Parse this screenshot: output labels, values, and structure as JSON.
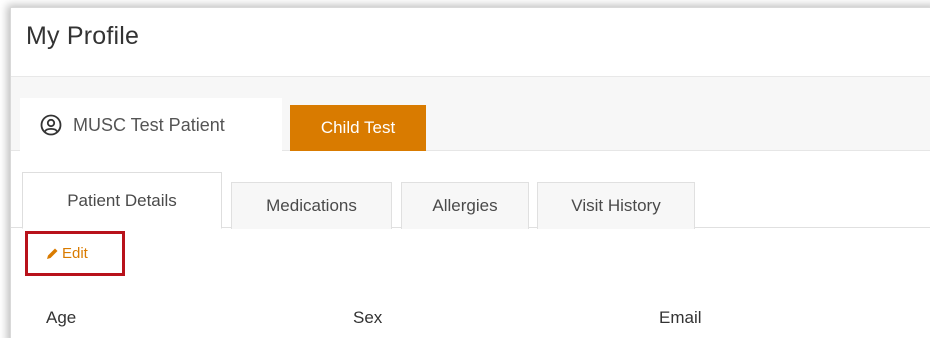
{
  "page": {
    "title": "My Profile"
  },
  "patients": {
    "primary": {
      "label": "MUSC Test Patient",
      "icon": "user-circle-icon"
    },
    "child": {
      "label": "Child Test"
    }
  },
  "tabs": [
    {
      "label": "Patient Details",
      "active": true
    },
    {
      "label": "Medications",
      "active": false
    },
    {
      "label": "Allergies",
      "active": false
    },
    {
      "label": "Visit History",
      "active": false
    }
  ],
  "actions": {
    "edit_label": "Edit",
    "edit_icon": "pencil-icon"
  },
  "fields": {
    "age_label": "Age",
    "sex_label": "Sex",
    "email_label": "Email"
  },
  "colors": {
    "accent": "#d97b00",
    "highlight_border": "#b8121b"
  }
}
